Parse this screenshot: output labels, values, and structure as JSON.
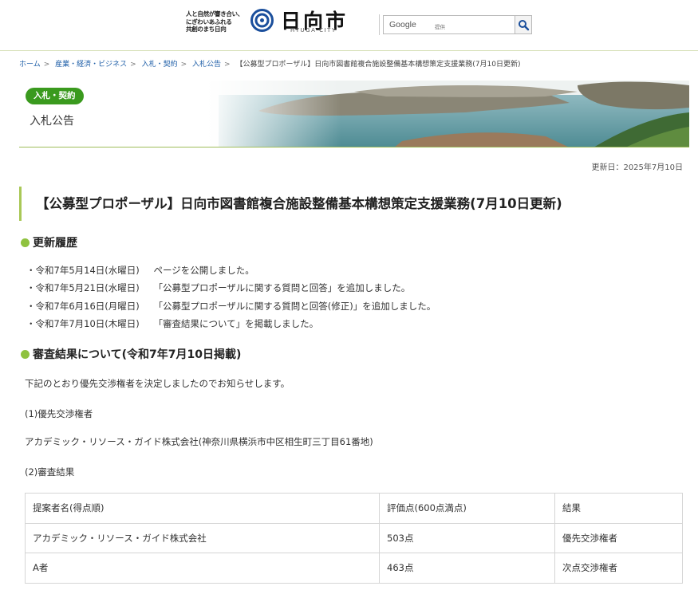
{
  "header": {
    "tagline_lines": [
      "人と自然が響き合い、",
      "にぎわいあふれる",
      "共創のまち日向"
    ],
    "city_name": "日向市",
    "city_name_roman": "HYUGA CITY",
    "search": {
      "brand": "Google",
      "brand_sub": "提供",
      "button_icon": "search-icon"
    }
  },
  "breadcrumb": {
    "links": [
      "ホーム",
      "産業・経済・ビジネス",
      "入札・契約",
      "入札公告"
    ],
    "current": "【公募型プロポーザル】日向市図書館複合施設整備基本構想策定支援業務(7月10日更新)"
  },
  "banner": {
    "badge": "入札・契約",
    "section_name": "入札公告"
  },
  "updated": "更新日：2025年7月10日",
  "page_title": "【公募型プロポーザル】日向市図書館複合施設整備基本構想策定支援業務(7月10日更新)",
  "history": {
    "heading": "更新履歴",
    "items": [
      {
        "date": "令和7年5月14日(水曜日)",
        "text": "ページを公開しました。"
      },
      {
        "date": "令和7年5月21日(水曜日)",
        "text": "「公募型プロポーザルに関する質問と回答」を追加しました。"
      },
      {
        "date": "令和7年6月16日(月曜日)",
        "text": "「公募型プロポーザルに関する質問と回答(修正)」を追加しました。"
      },
      {
        "date": "令和7年7月10日(木曜日)",
        "text": "「審査結果について」を掲載しました。"
      }
    ]
  },
  "result": {
    "heading": "審査結果について(令和7年7月10日掲載)",
    "intro": "下記のとおり優先交渉権者を決定しましたのでお知らせします。",
    "sub1": "(1)優先交渉権者",
    "winner": "アカデミック・リソース・ガイド株式会社(神奈川県横浜市中区相生町三丁目61番地)",
    "sub2": "(2)審査結果",
    "table": {
      "headers": [
        "提案者名(得点順)",
        "評価点(600点満点)",
        "結果"
      ],
      "rows": [
        [
          "アカデミック・リソース・ガイド株式会社",
          "503点",
          "優先交渉権者"
        ],
        [
          "A者",
          "463点",
          "次点交渉権者"
        ]
      ]
    }
  },
  "colors": {
    "accent_green": "#3a9a1e",
    "bullet_green": "#8fc23f",
    "link_blue": "#1f5fa8",
    "rule_green": "#a9c857"
  }
}
